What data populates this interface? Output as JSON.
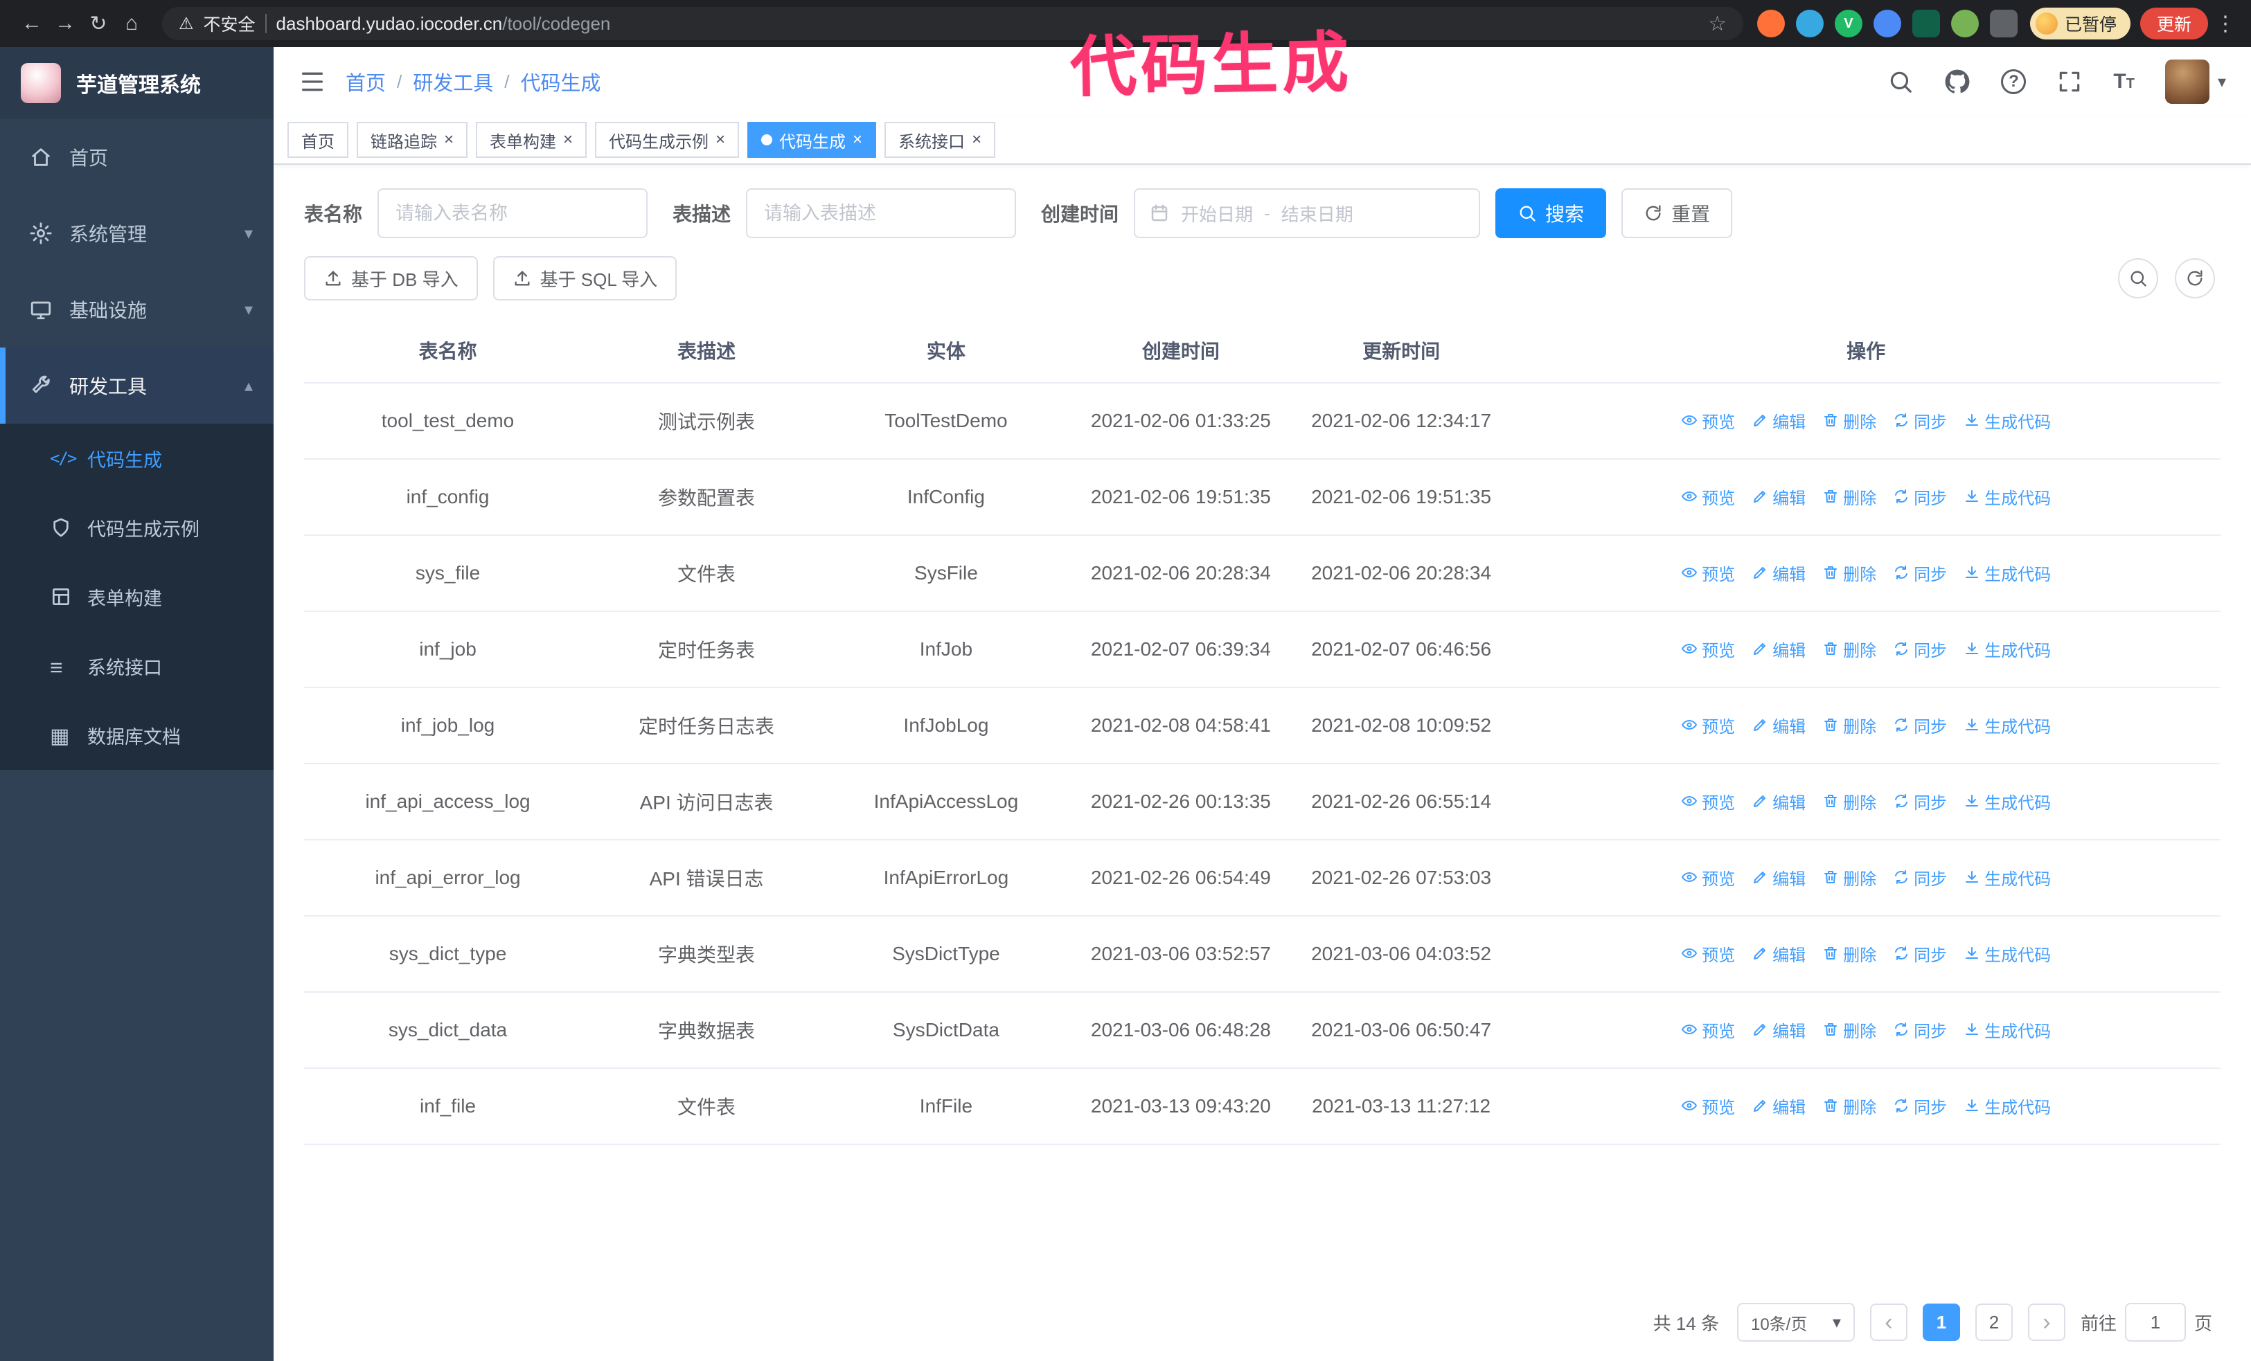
{
  "annotation": {
    "text": "代码生成",
    "color": "#fb3570"
  },
  "browser": {
    "security_label": "不安全",
    "url_domain": "dashboard.yudao.iocoder.cn",
    "url_path": "/tool/codegen",
    "paused_badge": "已暂停",
    "update_button": "更新"
  },
  "sidebar": {
    "logo_title": "芋道管理系统",
    "items": [
      {
        "label": "首页"
      },
      {
        "label": "系统管理"
      },
      {
        "label": "基础设施"
      },
      {
        "label": "研发工具"
      }
    ],
    "subitems": [
      {
        "label": "代码生成",
        "active": true
      },
      {
        "label": "代码生成示例"
      },
      {
        "label": "表单构建"
      },
      {
        "label": "系统接口"
      },
      {
        "label": "数据库文档"
      }
    ]
  },
  "breadcrumb": [
    "首页",
    "研发工具",
    "代码生成"
  ],
  "tabs": [
    {
      "label": "首页"
    },
    {
      "label": "链路追踪"
    },
    {
      "label": "表单构建"
    },
    {
      "label": "代码生成示例"
    },
    {
      "label": "代码生成",
      "active": true
    },
    {
      "label": "系统接口"
    }
  ],
  "filters": {
    "name_label": "表名称",
    "name_placeholder": "请输入表名称",
    "desc_label": "表描述",
    "desc_placeholder": "请输入表描述",
    "time_label": "创建时间",
    "date_start": "开始日期",
    "date_separator": "-",
    "date_end": "结束日期",
    "search_button": "搜索",
    "reset_button": "重置"
  },
  "toolbar": {
    "import_db": "基于 DB 导入",
    "import_sql": "基于 SQL 导入"
  },
  "table": {
    "headers": {
      "name": "表名称",
      "desc": "表描述",
      "entity": "实体",
      "created": "创建时间",
      "updated": "更新时间",
      "actions": "操作"
    },
    "action_labels": {
      "preview": "预览",
      "edit": "编辑",
      "delete": "删除",
      "sync": "同步",
      "generate": "生成代码"
    },
    "rows": [
      {
        "name": "tool_test_demo",
        "desc": "测试示例表",
        "entity": "ToolTestDemo",
        "created": "2021-02-06 01:33:25",
        "updated": "2021-02-06 12:34:17"
      },
      {
        "name": "inf_config",
        "desc": "参数配置表",
        "entity": "InfConfig",
        "created": "2021-02-06 19:51:35",
        "updated": "2021-02-06 19:51:35"
      },
      {
        "name": "sys_file",
        "desc": "文件表",
        "entity": "SysFile",
        "created": "2021-02-06 20:28:34",
        "updated": "2021-02-06 20:28:34"
      },
      {
        "name": "inf_job",
        "desc": "定时任务表",
        "entity": "InfJob",
        "created": "2021-02-07 06:39:34",
        "updated": "2021-02-07 06:46:56"
      },
      {
        "name": "inf_job_log",
        "desc": "定时任务日志表",
        "entity": "InfJobLog",
        "created": "2021-02-08 04:58:41",
        "updated": "2021-02-08 10:09:52"
      },
      {
        "name": "inf_api_access_log",
        "desc": "API 访问日志表",
        "entity": "InfApiAccessLog",
        "created": "2021-02-26 00:13:35",
        "updated": "2021-02-26 06:55:14"
      },
      {
        "name": "inf_api_error_log",
        "desc": "API 错误日志",
        "entity": "InfApiErrorLog",
        "created": "2021-02-26 06:54:49",
        "updated": "2021-02-26 07:53:03"
      },
      {
        "name": "sys_dict_type",
        "desc": "字典类型表",
        "entity": "SysDictType",
        "created": "2021-03-06 03:52:57",
        "updated": "2021-03-06 04:03:52"
      },
      {
        "name": "sys_dict_data",
        "desc": "字典数据表",
        "entity": "SysDictData",
        "created": "2021-03-06 06:48:28",
        "updated": "2021-03-06 06:50:47"
      },
      {
        "name": "inf_file",
        "desc": "文件表",
        "entity": "InfFile",
        "created": "2021-03-13 09:43:20",
        "updated": "2021-03-13 11:27:12"
      }
    ]
  },
  "pagination": {
    "total": "共 14 条",
    "page_size": "10条/页",
    "pages": [
      "1",
      "2"
    ],
    "active_page": "1",
    "goto_label": "前往",
    "goto_value": "1",
    "goto_suffix": "页"
  },
  "colors": {
    "accent": "#409eff",
    "search_button": "#1890ff",
    "sidebar_bg": "#304156",
    "submenu_bg": "#1f2d3d",
    "annotation": "#fb3570",
    "update_button": "#e5483d"
  }
}
